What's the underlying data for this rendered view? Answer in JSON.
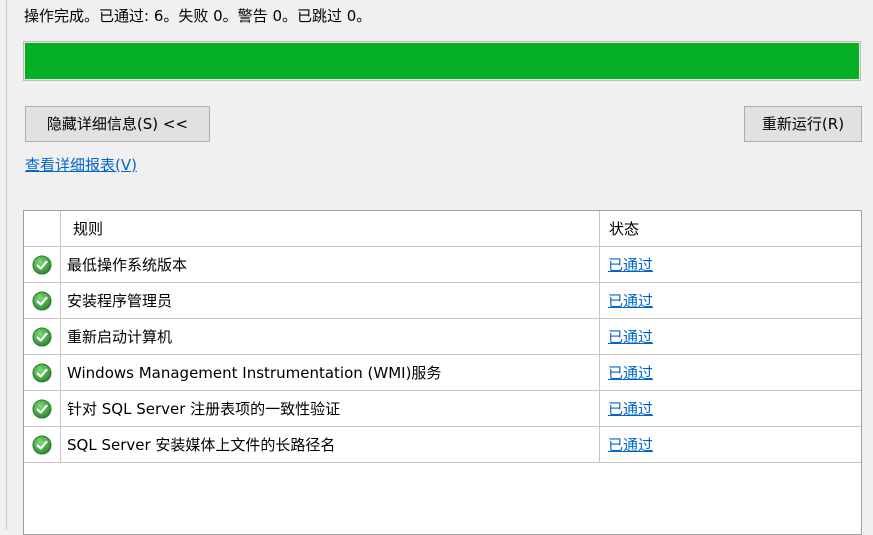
{
  "summary_text": "操作完成。已通过: 6。失败 0。警告 0。已跳过 0。",
  "progress": {
    "value_percent": 100,
    "color": "#06b025"
  },
  "buttons": {
    "hide_details": "隐藏详细信息(S) <<",
    "rerun": "重新运行(R)"
  },
  "report_link": "查看详细报表(V)",
  "table": {
    "columns": {
      "rule": "规则",
      "status": "状态"
    },
    "rows": [
      {
        "rule": "最低操作系统版本",
        "status": "已通过",
        "icon": "check-circle-icon"
      },
      {
        "rule": "安装程序管理员",
        "status": "已通过",
        "icon": "check-circle-icon"
      },
      {
        "rule": "重新启动计算机",
        "status": "已通过",
        "icon": "check-circle-icon"
      },
      {
        "rule": "Windows Management Instrumentation (WMI)服务",
        "status": "已通过",
        "icon": "check-circle-icon"
      },
      {
        "rule": "针对 SQL Server 注册表项的一致性验证",
        "status": "已通过",
        "icon": "check-circle-icon"
      },
      {
        "rule": "SQL Server 安装媒体上文件的长路径名",
        "status": "已通过",
        "icon": "check-circle-icon"
      }
    ]
  },
  "colors": {
    "accent_link": "#0066cc",
    "pass_green": "#3fa33f"
  }
}
